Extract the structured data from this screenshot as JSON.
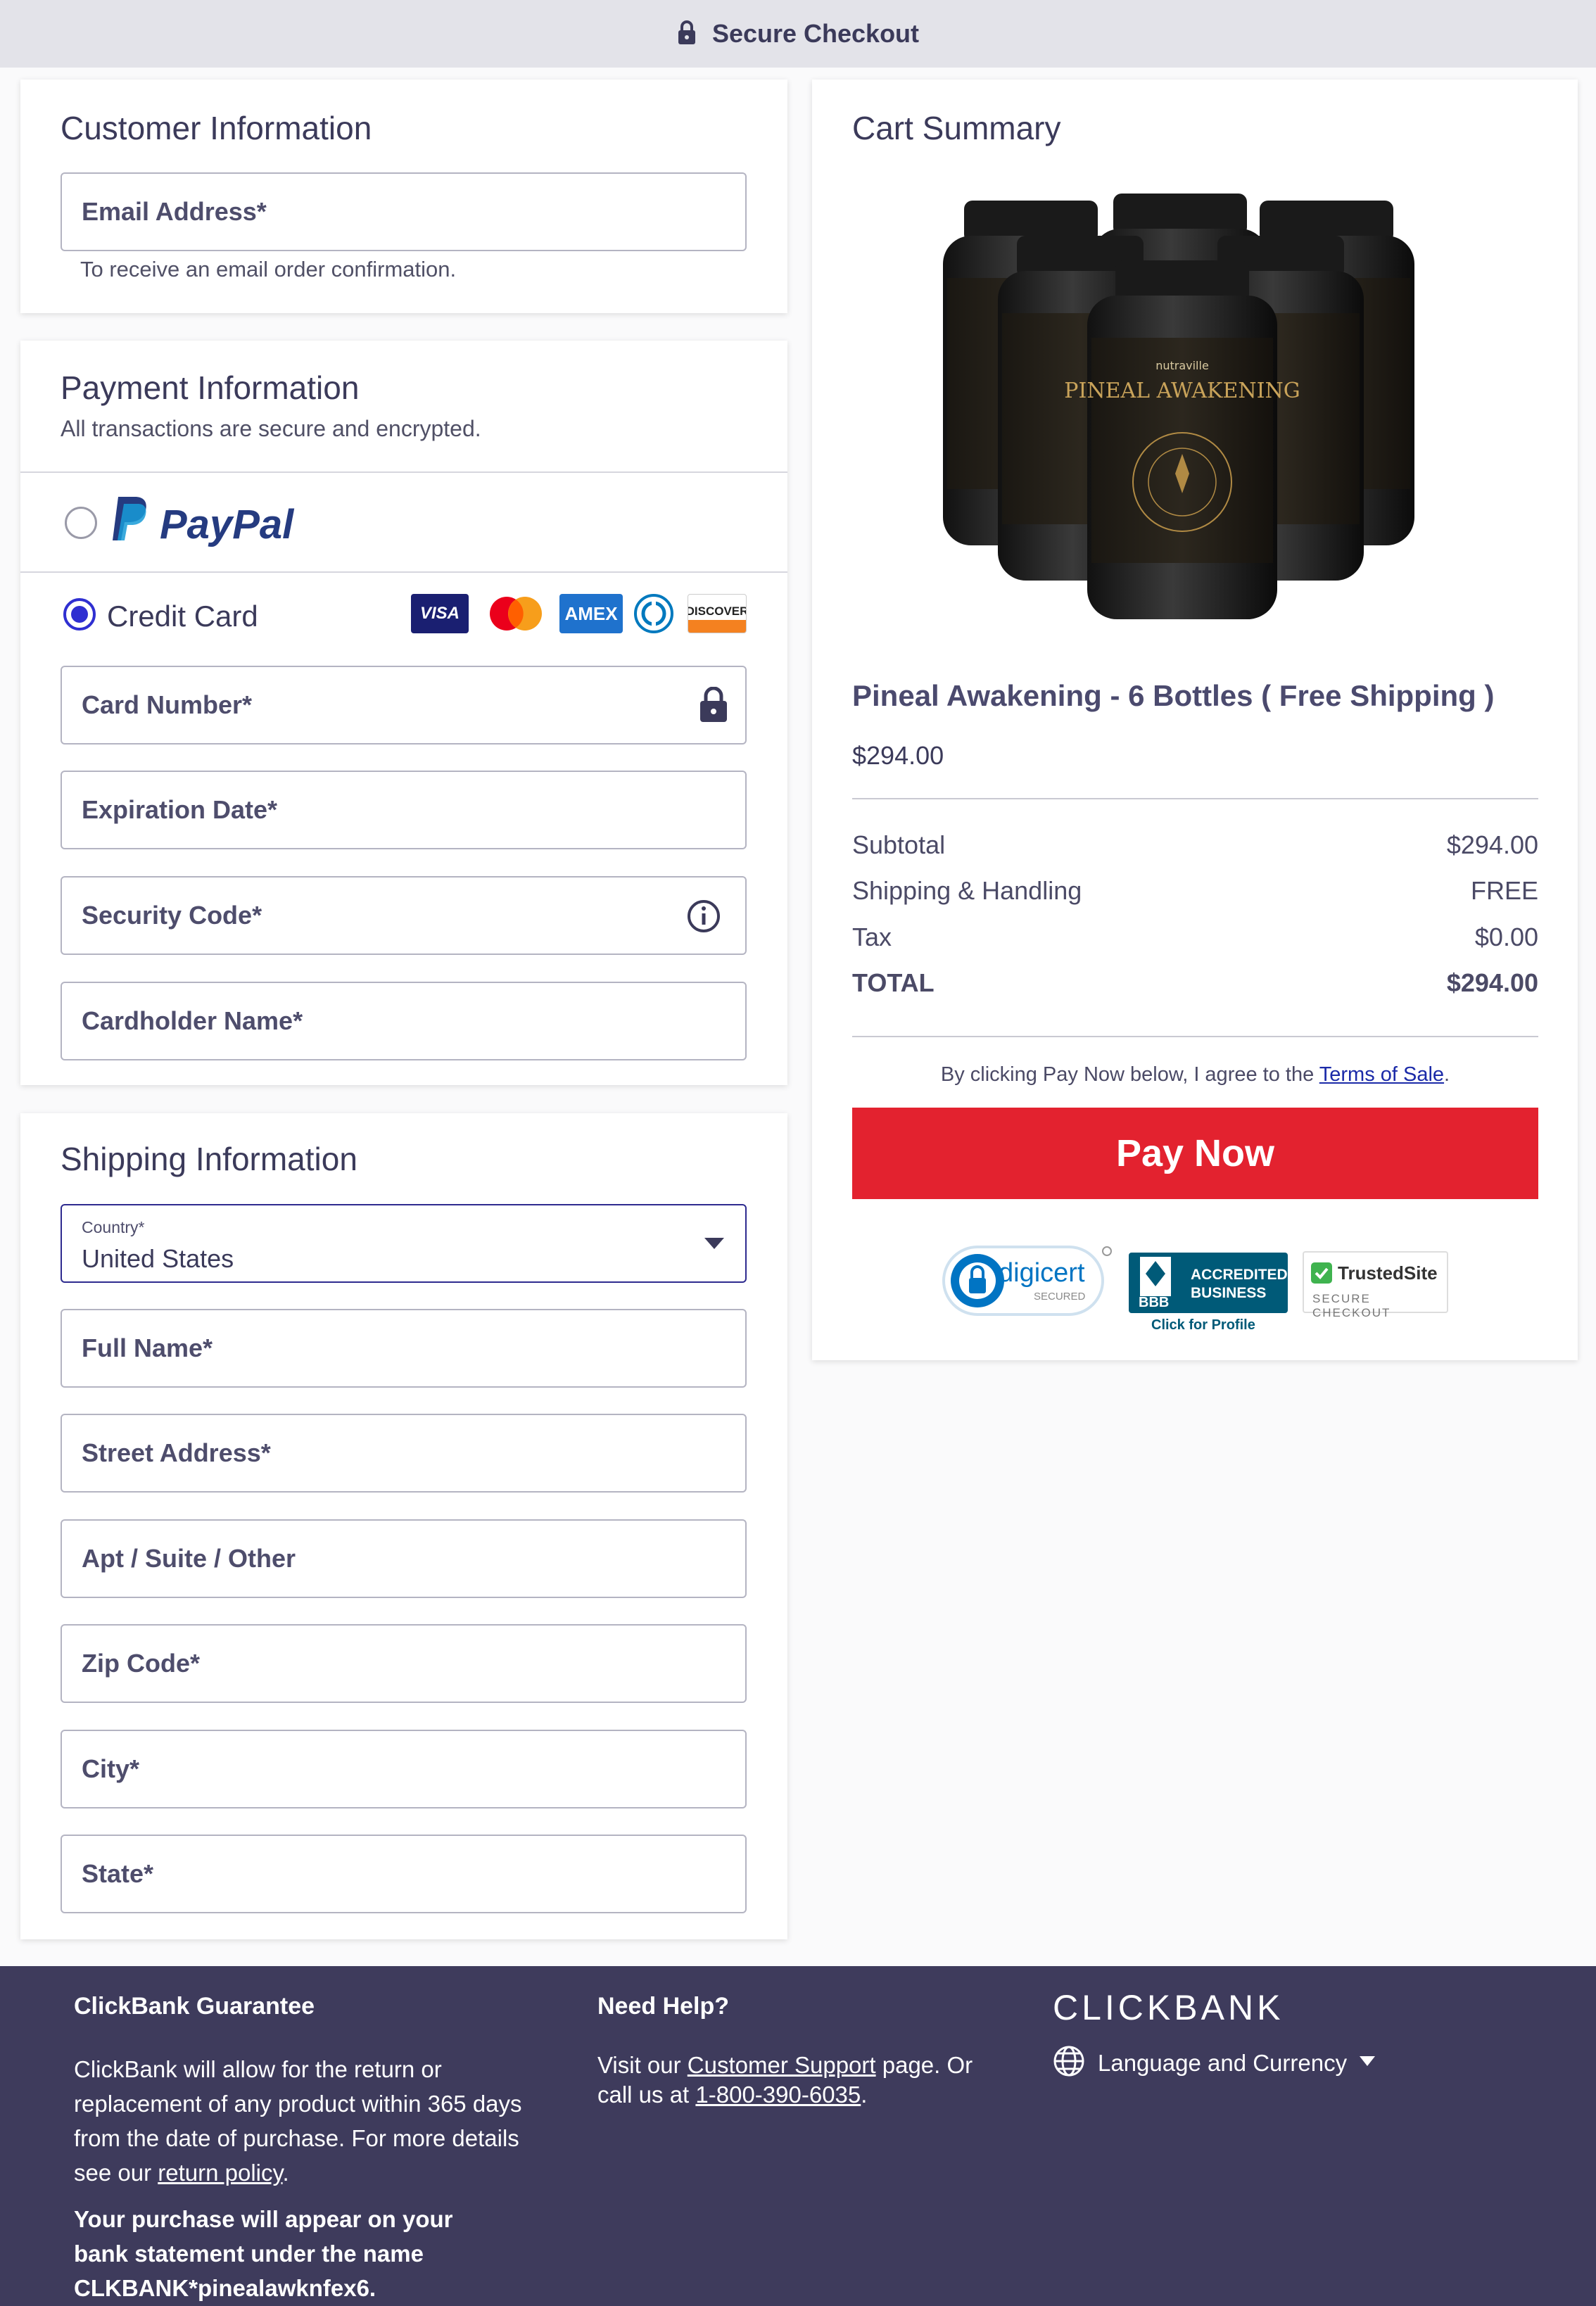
{
  "header": {
    "title": "Secure Checkout"
  },
  "customer": {
    "title": "Customer Information",
    "email_label": "Email Address*",
    "email_help": "To receive an email order confirmation."
  },
  "payment": {
    "title": "Payment Information",
    "subtitle": "All transactions are secure and encrypted.",
    "paypal_label": "PayPal",
    "paypal_selected": false,
    "credit_label": "Credit Card",
    "credit_selected": true,
    "card_brands": [
      "VISA",
      "Mastercard",
      "AMEX",
      "Diners Club",
      "DISCOVER"
    ],
    "card_number_label": "Card Number*",
    "expiration_label": "Expiration Date*",
    "security_label": "Security Code*",
    "cardholder_label": "Cardholder Name*"
  },
  "shipping": {
    "title": "Shipping Information",
    "country_label": "Country*",
    "country_value": "United States",
    "full_name_label": "Full Name*",
    "street_label": "Street Address*",
    "apt_label": "Apt / Suite / Other",
    "zip_label": "Zip Code*",
    "city_label": "City*",
    "state_label": "State*"
  },
  "cart": {
    "title": "Cart Summary",
    "product_name": "Pineal Awakening - 6 Bottles ( Free Shipping )",
    "product_price": "$294.00",
    "bottle_brand": "nutraville",
    "bottle_title": "PINEAL AWAKENING",
    "rows": [
      {
        "label": "Subtotal",
        "value": "$294.00"
      },
      {
        "label": "Shipping & Handling",
        "value": "FREE"
      },
      {
        "label": "Tax",
        "value": "$0.00"
      }
    ],
    "total_label": "TOTAL",
    "total_value": "$294.00",
    "agree_prefix": "By clicking Pay Now below, I agree to the ",
    "agree_link": "Terms of Sale",
    "agree_suffix": ".",
    "pay_button": "Pay Now",
    "badges": {
      "digicert": "digicert",
      "digicert_sub": "SECURED",
      "bbb_line1": "ACCREDITED",
      "bbb_line2": "BUSINESS",
      "bbb_logo": "BBB",
      "bbb_click": "Click for Profile",
      "trusted": "TrustedSite",
      "trusted_sub": "SECURE CHECKOUT"
    }
  },
  "footer": {
    "guarantee_title": "ClickBank Guarantee",
    "guarantee_text": "ClickBank will allow for the return or replacement of any product within 365 days from the date of purchase. For more details see our ",
    "guarantee_link": "return policy",
    "guarantee_end": ".",
    "statement_text": "Your purchase will appear on your bank statement under the name CLKBANK*pinealawknfex6.",
    "help_title": "Need Help?",
    "help_prefix": "Visit our ",
    "help_link": "Customer Support",
    "help_mid": " page. Or call us at ",
    "help_phone": "1-800-390-6035",
    "help_end": ".",
    "brand": "CLICKBANK",
    "language_label": "Language and Currency"
  },
  "colors": {
    "accent": "#2f2fd1",
    "pay_button": "#e3222f",
    "footer_bg": "#3e3b5c",
    "header_bg": "#e3e3e9"
  }
}
